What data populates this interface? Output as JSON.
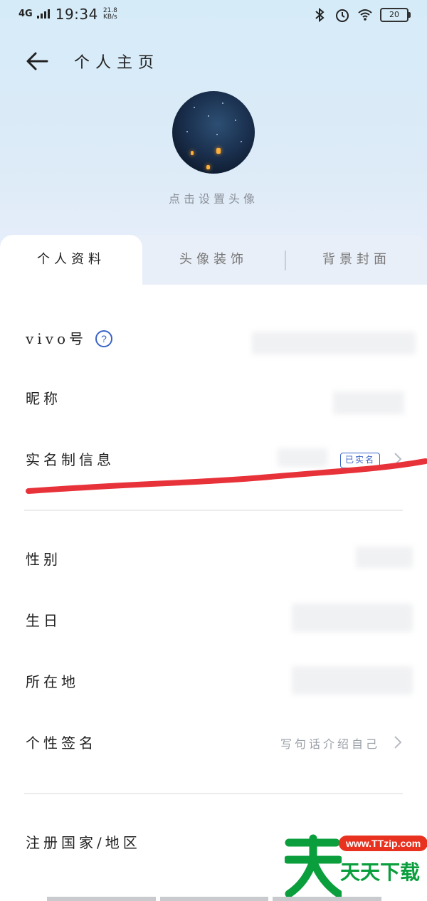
{
  "status_bar": {
    "network": "4G",
    "time": "19:34",
    "speed_value": "21.8",
    "speed_unit": "KB/s",
    "battery": "20"
  },
  "header": {
    "title": "个人主页"
  },
  "avatar": {
    "hint": "点击设置头像"
  },
  "tabs": [
    {
      "label": "个人资料",
      "active": true
    },
    {
      "label": "头像装饰",
      "active": false
    },
    {
      "label": "背景封面",
      "active": false
    }
  ],
  "rows": {
    "vivo_id": {
      "label": "vivo号"
    },
    "nickname": {
      "label": "昵称"
    },
    "real_name": {
      "label": "实名制信息",
      "badge": "已实名"
    },
    "gender": {
      "label": "性别"
    },
    "birthday": {
      "label": "生日"
    },
    "location": {
      "label": "所在地"
    },
    "signature": {
      "label": "个性签名",
      "value": "写句话介绍自己"
    },
    "region": {
      "label": "注册国家/地区"
    }
  },
  "watermark": {
    "url": "www.TTzip.com",
    "text": "天天下载"
  },
  "colors": {
    "accent_blue": "#3b63c7",
    "annotation_red": "#e8323a"
  }
}
